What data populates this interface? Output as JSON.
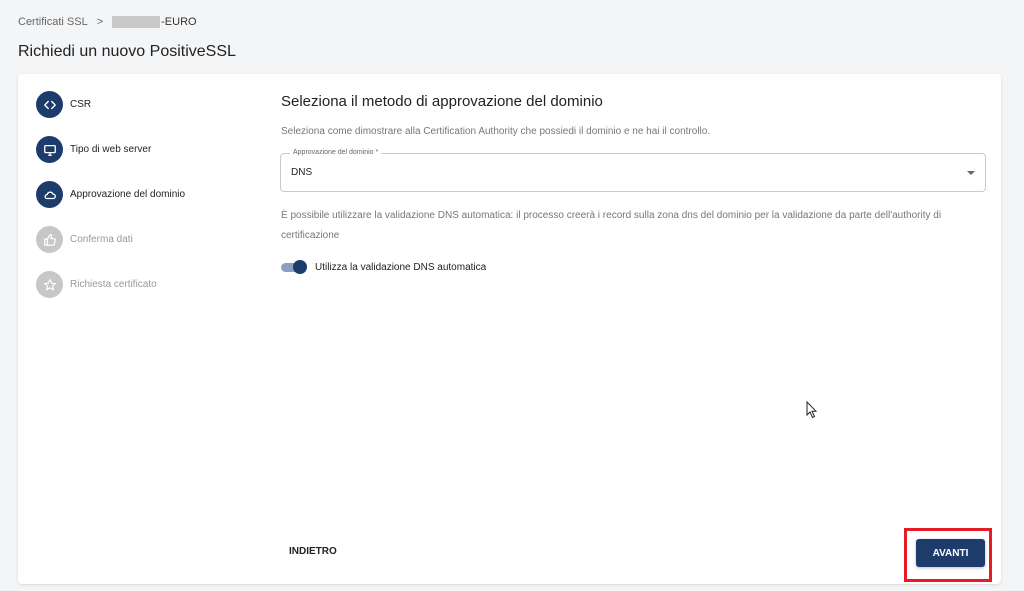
{
  "breadcrumb": {
    "root": "Certificati SSL",
    "separator": ">",
    "current": "-EURO"
  },
  "page": {
    "title": "Richiedi un nuovo PositiveSSL"
  },
  "stepper": {
    "steps": [
      {
        "label": "CSR",
        "icon": "code-icon",
        "state": "active"
      },
      {
        "label": "Tipo di web server",
        "icon": "monitor-icon",
        "state": "active"
      },
      {
        "label": "Approvazione del dominio",
        "icon": "cloud-icon",
        "state": "active"
      },
      {
        "label": "Conferma dati",
        "icon": "thumbs-up-icon",
        "state": "inactive"
      },
      {
        "label": "Richiesta certificato",
        "icon": "star-icon",
        "state": "inactive"
      }
    ]
  },
  "content": {
    "title": "Seleziona il metodo di approvazione del dominio",
    "description": "Seleziona come dimostrare alla Certification Authority che possiedi il dominio e ne hai il controllo.",
    "select": {
      "label": "Approvazione del dominio *",
      "value": "DNS"
    },
    "info": "È possibile utilizzare la validazione DNS automatica: il processo creerà i record sulla zona dns del dominio per la validazione da parte dell'authority di certificazione",
    "toggle": {
      "label": "Utilizza la validazione DNS automatica",
      "checked": true
    }
  },
  "actions": {
    "back_label": "INDIETRO",
    "next_label": "AVANTI"
  },
  "colors": {
    "primary": "#1d3c6c",
    "highlight": "#e51c23",
    "inactive": "#c7c7c7"
  }
}
